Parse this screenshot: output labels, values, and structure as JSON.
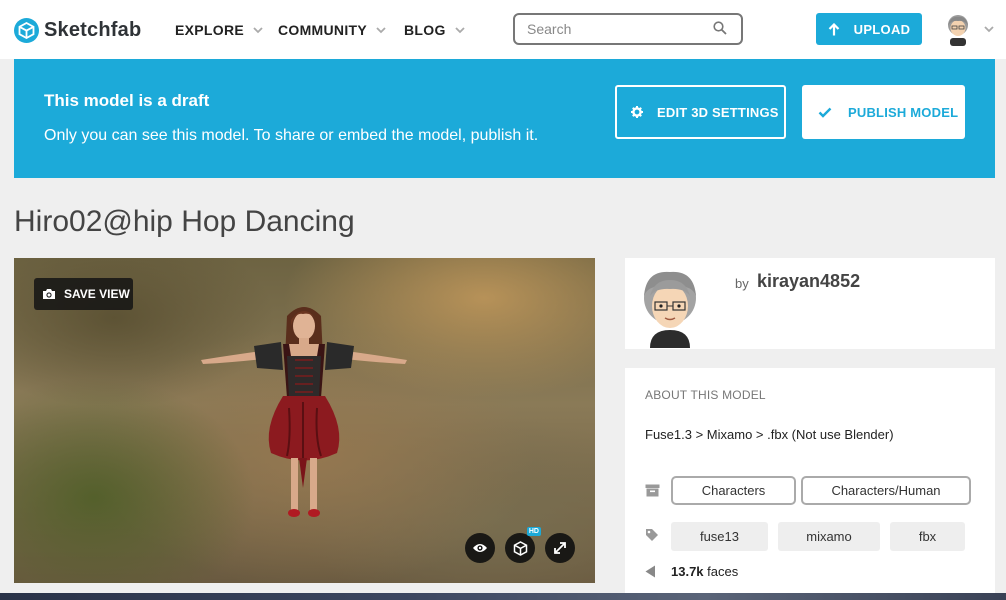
{
  "header": {
    "brand": "Sketchfab",
    "nav": [
      {
        "label": "EXPLORE"
      },
      {
        "label": "COMMUNITY"
      },
      {
        "label": "BLOG"
      }
    ],
    "search_placeholder": "Search",
    "upload_label": "UPLOAD"
  },
  "banner": {
    "title": "This model is a draft",
    "text": "Only you can see this model. To share or embed the model, publish it.",
    "edit_label": "EDIT 3D SETTINGS",
    "publish_label": "PUBLISH MODEL"
  },
  "model": {
    "title": "Hiro02@hip Hop Dancing",
    "save_view_label": "SAVE VIEW",
    "hd_badge": "HD"
  },
  "author": {
    "by": "by",
    "name": "kirayan4852"
  },
  "about": {
    "heading": "ABOUT THIS MODEL",
    "description": "Fuse1.3 > Mixamo > .fbx (Not use Blender)",
    "categories": [
      "Characters",
      "Characters/Human"
    ],
    "tags": [
      "fuse13",
      "mixamo",
      "fbx"
    ],
    "faces_value": "13.7k",
    "faces_label": "faces"
  },
  "colors": {
    "accent": "#1caad9"
  }
}
